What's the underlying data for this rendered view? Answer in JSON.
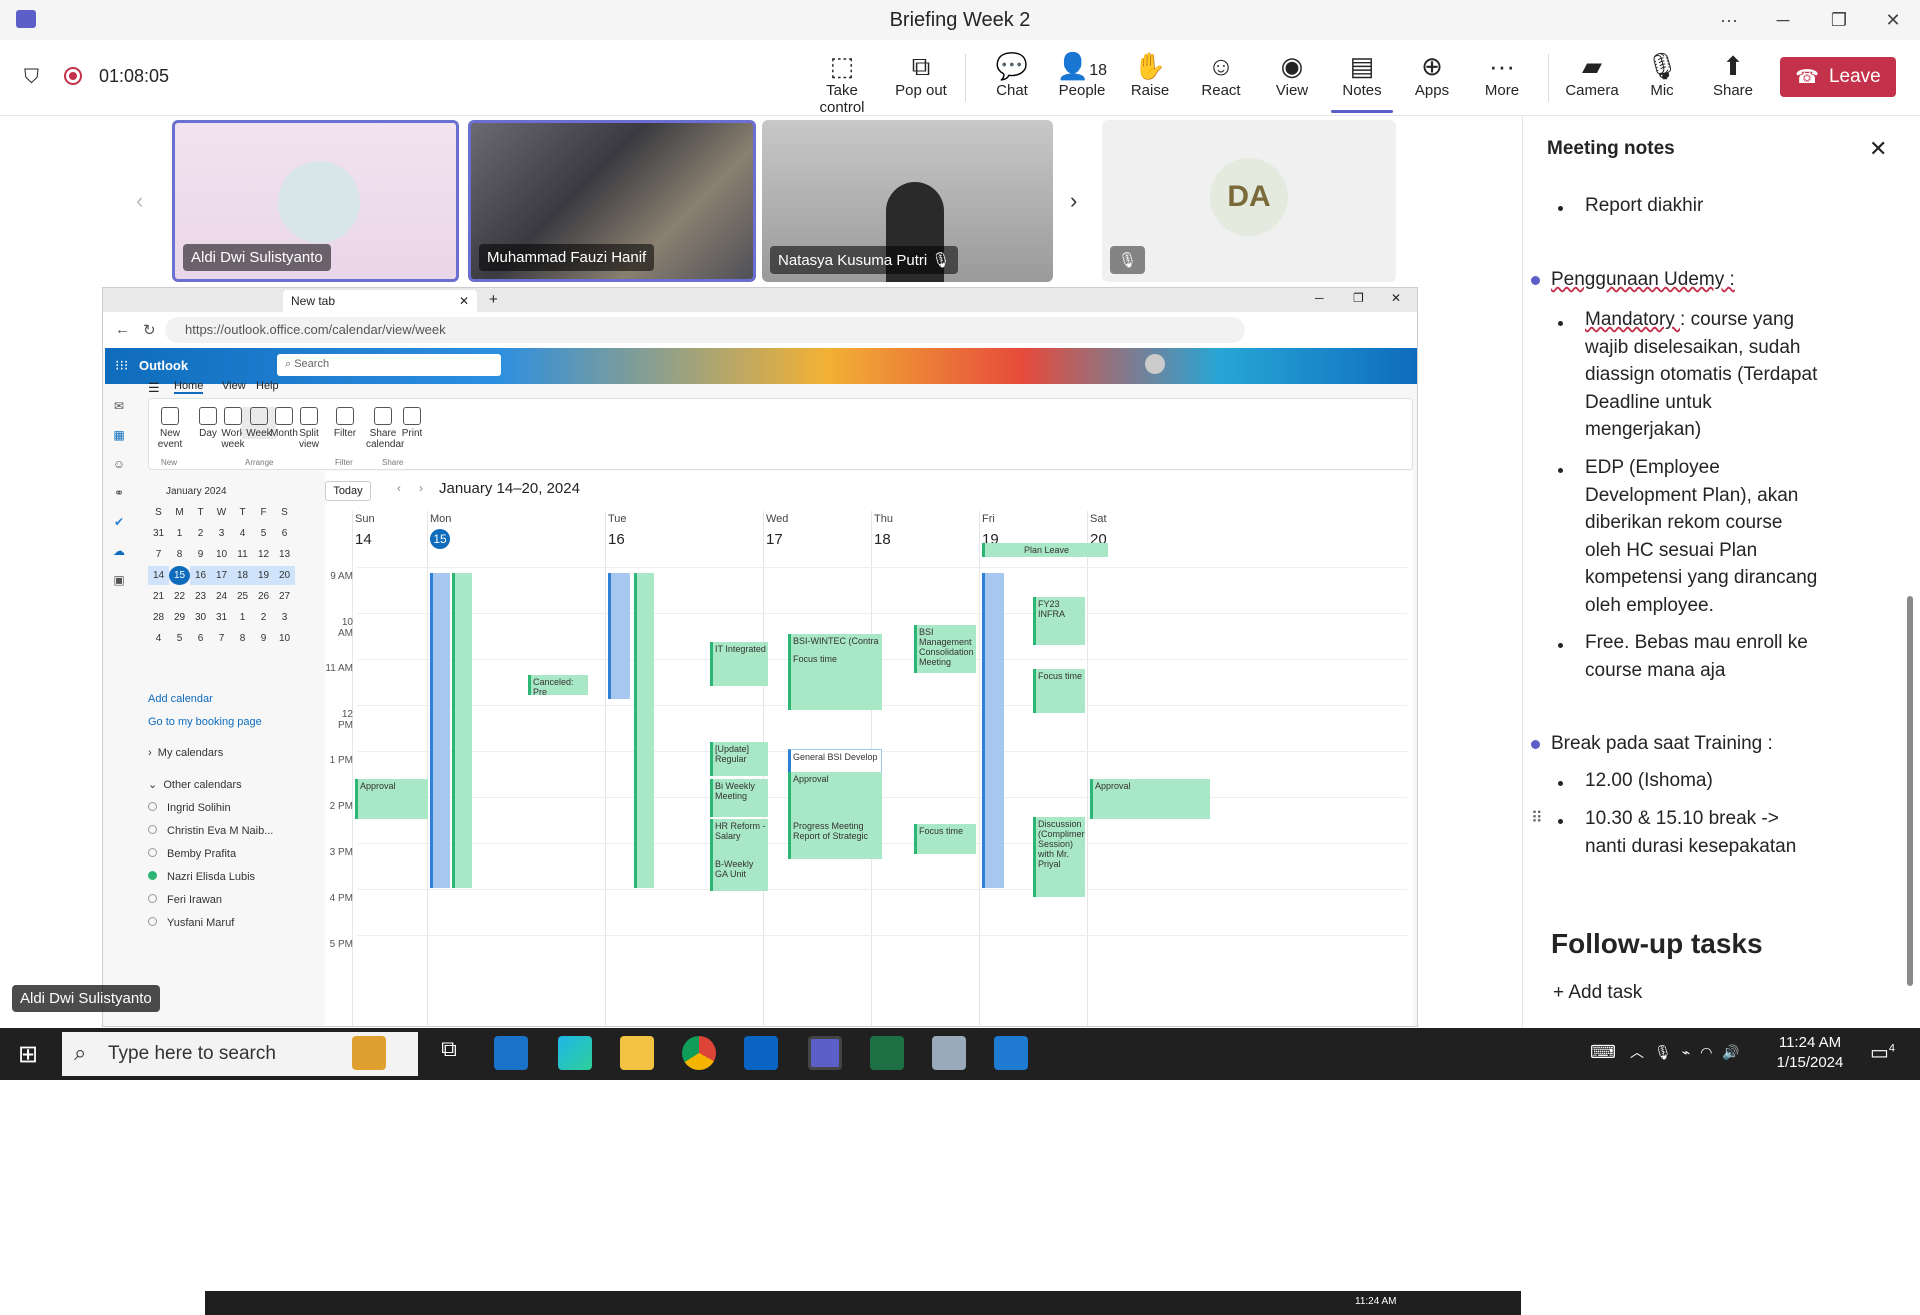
{
  "window": {
    "title": "Briefing Week 2"
  },
  "meeting": {
    "timer": "01:08:05",
    "people_count": "18",
    "leave_label": "Leave"
  },
  "toolbar": [
    {
      "name": "take-control",
      "label": "Take control",
      "icon": "take-control-icon"
    },
    {
      "name": "pop-out",
      "label": "Pop out",
      "icon": "pop-out-icon"
    },
    {
      "name": "chat",
      "label": "Chat",
      "icon": "chat-icon"
    },
    {
      "name": "people",
      "label": "People",
      "icon": "people-icon"
    },
    {
      "name": "raise",
      "label": "Raise",
      "icon": "hand-icon"
    },
    {
      "name": "react",
      "label": "React",
      "icon": "smile-icon"
    },
    {
      "name": "view",
      "label": "View",
      "icon": "view-icon"
    },
    {
      "name": "notes",
      "label": "Notes",
      "icon": "notes-icon"
    },
    {
      "name": "apps",
      "label": "Apps",
      "icon": "apps-icon"
    },
    {
      "name": "more",
      "label": "More",
      "icon": "more-icon"
    },
    {
      "name": "camera",
      "label": "Camera",
      "icon": "camera-off-icon"
    },
    {
      "name": "mic",
      "label": "Mic",
      "icon": "mic-off-icon"
    },
    {
      "name": "share",
      "label": "Share",
      "icon": "share-icon"
    }
  ],
  "participants": [
    {
      "name": "Aldi Dwi Sulistyanto"
    },
    {
      "name": "Muhammad Fauzi Hanif"
    },
    {
      "name": "Natasya Kusuma Putri"
    },
    {
      "initials": "DA"
    }
  ],
  "browser": {
    "tab_label": "New tab",
    "url": "https://outlook.office.com/calendar/view/week",
    "app_name": "Outlook",
    "search_placeholder": "Search",
    "ribbon_tabs": [
      "Home",
      "View",
      "Help"
    ],
    "ribbon_buttons": [
      "New event",
      "Day",
      "Work week",
      "Week",
      "Month",
      "Split view",
      "Filter",
      "Share calendar",
      "Print"
    ],
    "ribbon_groups": [
      "New",
      "Arrange",
      "Filter",
      "Share"
    ],
    "minical": {
      "month": "January 2024",
      "dow": [
        "S",
        "M",
        "T",
        "W",
        "T",
        "F",
        "S"
      ],
      "days": [
        "31",
        "1",
        "2",
        "3",
        "4",
        "5",
        "6",
        "7",
        "8",
        "9",
        "10",
        "11",
        "12",
        "13",
        "14",
        "15",
        "16",
        "17",
        "18",
        "19",
        "20",
        "21",
        "22",
        "23",
        "24",
        "25",
        "26",
        "27",
        "28",
        "29",
        "30",
        "31",
        "1",
        "2",
        "3",
        "4",
        "5",
        "6",
        "7",
        "8",
        "9",
        "10"
      ]
    },
    "links": [
      "Add calendar",
      "Go to my booking page"
    ],
    "my_calendars": "My calendars",
    "other_calendars": "Other calendars",
    "people": [
      "Ingrid Solihin",
      "Christin Eva M Naib...",
      "Bemby Prafita",
      "Nazri Elisda Lubis",
      "Feri Irawan",
      "Yusfani Maruf"
    ],
    "today_btn": "Today",
    "range": "January 14–20, 2024",
    "days": [
      {
        "dow": "Sun",
        "num": "14"
      },
      {
        "dow": "Mon",
        "num": "15"
      },
      {
        "dow": "Tue",
        "num": "16"
      },
      {
        "dow": "Wed",
        "num": "17"
      },
      {
        "dow": "Thu",
        "num": "18"
      },
      {
        "dow": "Fri",
        "num": "19"
      },
      {
        "dow": "Sat",
        "num": "20"
      }
    ],
    "hours": [
      "9 AM",
      "10 AM",
      "11 AM",
      "12 PM",
      "1 PM",
      "2 PM",
      "3 PM",
      "4 PM",
      "5 PM"
    ],
    "plan_leave": "Plan Leave",
    "events": {
      "approval": "Approval",
      "bsi": "BSI-WINTEC (Contra",
      "focus": "Focus time",
      "general": "General BSI Develop",
      "progress": "Progress Meeting Report of Strategic",
      "hr": "HR Reform - Salary",
      "biweekly": "Bi Weekly Meeting",
      "update": "[Update] Regular",
      "bweekly_ga": "B-Weekly GA Unit",
      "it": "IT Integrated",
      "bsi_mgmt": "BSI Management Consolidation Meeting",
      "fy23": "FY23 INFRA",
      "discussion": "Discussion (Complimer Session) with Mr. Priyal",
      "canceled": "Canceled: Pre"
    },
    "taskbar_time": "11:24 AM"
  },
  "presenter_label": "Aldi Dwi Sulistyanto",
  "notes": {
    "title": "Meeting notes",
    "l1": "Report diakhir",
    "h1": "Penggunaan Udemy :",
    "m1a": "Mandatory ",
    "m1b": ": course yang",
    "m2": "wajib diselesaikan, sudah",
    "m3": "diassign otomatis (Terdapat",
    "m4": "Deadline untuk",
    "m5": "mengerjakan)",
    "e1": "EDP (Employee",
    "e2": "Development Plan), akan",
    "e3": "diberikan rekom course",
    "e4": "oleh HC sesuai Plan",
    "e5": "kompetensi yang dirancang",
    "e6": "oleh employee.",
    "f1": "Free. Bebas mau enroll ke",
    "f2": "course mana aja",
    "h2": "Break pada saat Training :",
    "b1": "12.00 (Ishoma)",
    "b2a": "10.30 & 15.10 break ->",
    "b2b": "nanti durasi kesepakatan",
    "followup": "Follow-up tasks",
    "add_task": "Add task"
  },
  "taskbar": {
    "search_placeholder": "Type here to search",
    "time": "11:24 AM",
    "date": "1/15/2024",
    "badge": "4"
  }
}
